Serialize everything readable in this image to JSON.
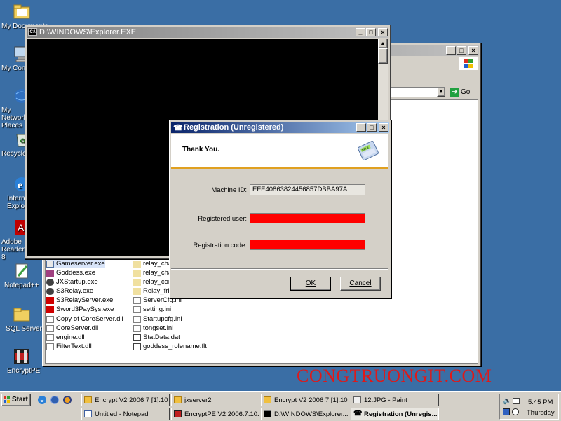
{
  "desktop": {
    "icons": [
      {
        "label": "My Documents",
        "id": "my-documents"
      },
      {
        "label": "My Computer",
        "id": "my-computer"
      },
      {
        "label": "My Network Places",
        "id": "my-network-places"
      },
      {
        "label": "Recycle Bin",
        "id": "recycle-bin"
      },
      {
        "label": "Internet Explorer",
        "id": "internet-explorer"
      },
      {
        "label": "Adobe Reader 8",
        "id": "adobe-reader"
      },
      {
        "label": "Notepad++",
        "id": "notepad-plus-plus"
      },
      {
        "label": "SQL Server",
        "id": "sql-server"
      },
      {
        "label": "EncryptPE",
        "id": "encryptpe"
      }
    ],
    "watermark": "CONGTRUONGIT.COM"
  },
  "console": {
    "title": "D:\\WINDOWS\\Explorer.EXE",
    "icon_text": "C:\\"
  },
  "explorer": {
    "go_label": "Go",
    "files_col1": [
      "Gameserver.exe",
      "Goddess.exe",
      "JXStartup.exe",
      "S3Relay.exe",
      "S3RelayServer.exe",
      "Sword3PaySys.exe",
      "Copy of CoreServer.dll",
      "CoreServer.dll",
      "engine.dll",
      "FilterText.dll"
    ],
    "files_col2": [
      "relay_cha",
      "relay_cha",
      "relay_con",
      "Relay_frie",
      "ServerCfg.ini",
      "setting.ini",
      "Startupcfg.ini",
      "tongset.ini",
      "StatData.dat",
      "goddess_rolename.flt"
    ]
  },
  "dialog": {
    "title": "Registration (Unregistered)",
    "heading": "Thank You.",
    "machine_id_label": "Machine ID:",
    "machine_id_value": "EFE40863824456857DBBA97A",
    "registered_user_label": "Registered user:",
    "registration_code_label": "Registration code:",
    "ok_label": "OK",
    "cancel_label": "Cancel",
    "redact_color": "#ff0000"
  },
  "taskbar": {
    "start_label": "Start",
    "tasks": [
      {
        "label": "Encrypt V2 2006 7 [1].10",
        "icon": "folder-icon"
      },
      {
        "label": "jxserver2",
        "icon": "folder-icon"
      },
      {
        "label": "Encrypt V2 2006 7 [1].10",
        "icon": "folder-icon"
      },
      {
        "label": "12.JPG - Paint",
        "icon": "paint-icon"
      },
      {
        "label": "Untitled - Notepad",
        "icon": "notepad-icon"
      },
      {
        "label": "EncryptPE V2.2006.7.10...",
        "icon": "encryptpe-icon"
      },
      {
        "label": "D:\\WINDOWS\\Explorer....",
        "icon": "console-icon"
      },
      {
        "label": "Registration (Unregis...",
        "icon": "registration-icon"
      }
    ],
    "clock_time": "5:45 PM",
    "clock_day": "Thursday"
  }
}
